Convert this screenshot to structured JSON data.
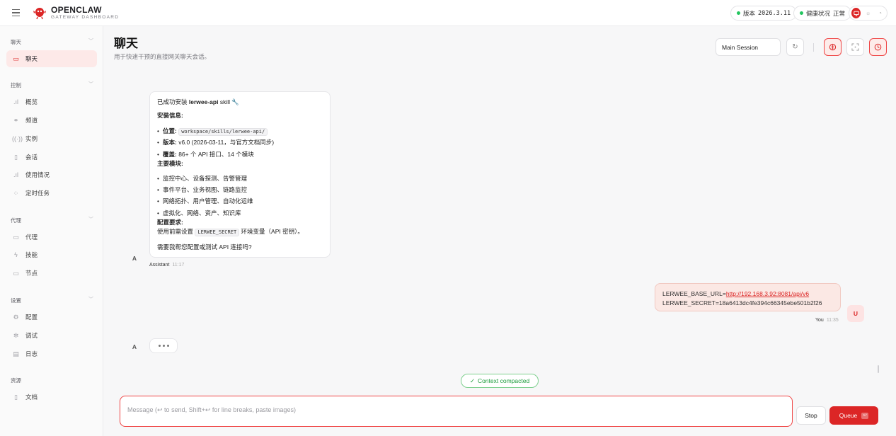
{
  "header": {
    "brand_title": "OPENCLAW",
    "brand_sub": "GATEWAY DASHBOARD",
    "version_label": "版本",
    "version_value": "2026.3.11",
    "health_label": "健康状况",
    "health_value": "正常",
    "theme_icons": [
      "monitor-icon",
      "sun-icon",
      "moon-icon"
    ]
  },
  "sidebar": {
    "groups": [
      {
        "label": "聊天",
        "items": [
          {
            "label": "聊天",
            "icon": "chat-icon",
            "active": true
          }
        ]
      },
      {
        "label": "控制",
        "items": [
          {
            "label": "概览",
            "icon": "bar-chart-icon"
          },
          {
            "label": "频道",
            "icon": "link-icon"
          },
          {
            "label": "实例",
            "icon": "radio-icon"
          },
          {
            "label": "会话",
            "icon": "file-icon"
          },
          {
            "label": "使用情况",
            "icon": "bar-chart-icon"
          },
          {
            "label": "定时任务",
            "icon": "loader-icon"
          }
        ]
      },
      {
        "label": "代理",
        "items": [
          {
            "label": "代理",
            "icon": "folder-icon"
          },
          {
            "label": "技能",
            "icon": "zap-icon"
          },
          {
            "label": "节点",
            "icon": "monitor-icon"
          }
        ]
      },
      {
        "label": "设置",
        "items": [
          {
            "label": "配置",
            "icon": "gear-icon"
          },
          {
            "label": "调试",
            "icon": "bug-icon"
          },
          {
            "label": "日志",
            "icon": "log-icon"
          }
        ]
      },
      {
        "label": "资源",
        "items": [
          {
            "label": "文档",
            "icon": "book-icon"
          }
        ]
      }
    ]
  },
  "page": {
    "title": "聊天",
    "subtitle": "用于快速干预的直接网关聊天会话。",
    "session": "Main Session"
  },
  "messages": {
    "assistant": {
      "avatar": "A",
      "intro_prefix": "已成功安装 ",
      "intro_bold": "lerwee-api",
      "intro_suffix": " skill 🔧",
      "install_heading": "安装信息:",
      "loc_label": "位置:",
      "loc_value": "workspace/skills/lerwee-api/",
      "ver_label": "版本:",
      "ver_value": " v6.0 (2026-03-11，与官方文档同步)",
      "cov_label": "覆盖:",
      "cov_value": " 86+ 个 API 接口、14 个模块",
      "modules_heading": "主要模块:",
      "modules": [
        "监控中心、设备探测、告警管理",
        "事件平台、业务视图、链路监控",
        "网络拓扑、用户管理、自动化运维",
        "虚拟化、网络、资产、知识库"
      ],
      "config_heading": "配置要求:",
      "config_prefix": "使用前需设置 ",
      "config_code": "LERWEE_SECRET",
      "config_suffix": " 环境变量（API 密钥）。",
      "question": "需要我帮您配置或测试 API 连接吗?",
      "sender": "Assistant",
      "time": "11:17"
    },
    "user": {
      "avatar": "U",
      "line1_prefix": "LERWEE_BASE_URL=",
      "line1_link": "http://192.168.3.92:8081/api/v6",
      "line2": "LERWEE_SECRET=18a6413dc4fe394c66345ebe501b2f26",
      "sender": "You",
      "time": "11:35"
    },
    "typing_avatar": "A",
    "context_pill": "Context compacted"
  },
  "composer": {
    "placeholder": "Message (↩ to send, Shift+↩ for line breaks, paste images)",
    "value": "",
    "stop_label": "Stop",
    "queue_label": "Queue"
  },
  "colors": {
    "accent": "#dc2626",
    "active_bg": "#fde9e8",
    "status_ok": "#22c55e"
  }
}
